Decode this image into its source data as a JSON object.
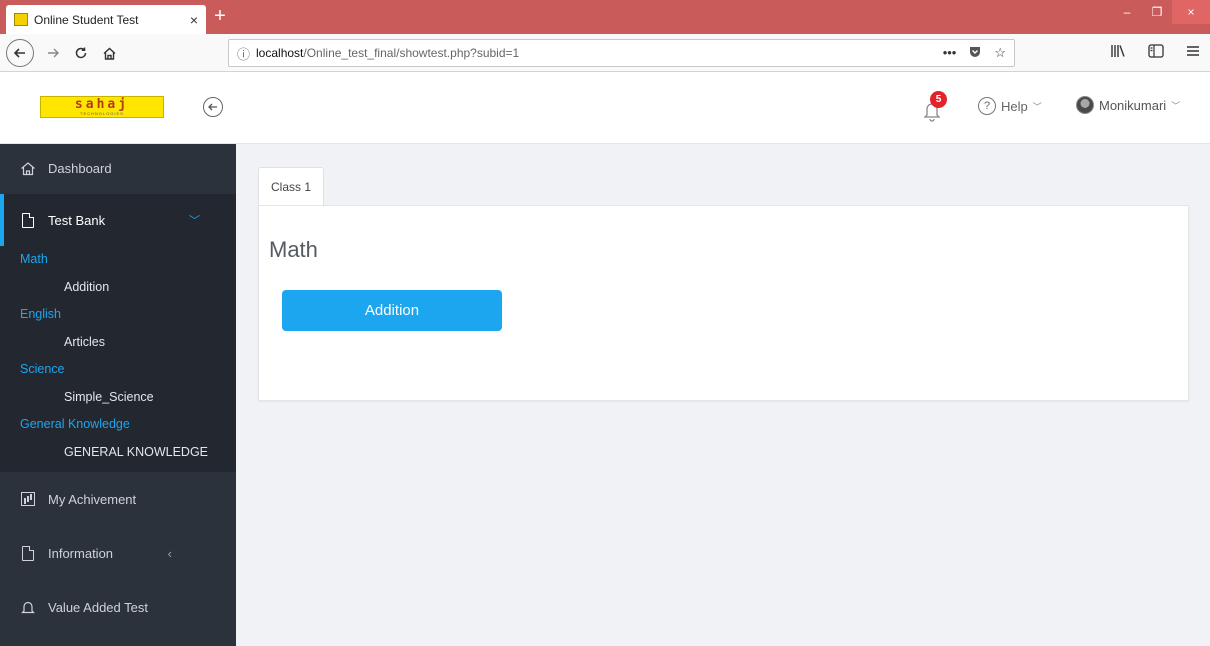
{
  "browser": {
    "tab_title": "Online Student Test",
    "tab_close": "×",
    "new_tab": "+",
    "url_host": "localhost",
    "url_path": "/Online_test_final/showtest.php?subid=1",
    "url_more": "•••",
    "win_min": "–",
    "win_max": "❐",
    "win_close": "×"
  },
  "header": {
    "logo_text": "sahaj",
    "logo_subtext": "TECHNOLOGIES",
    "notification_count": "5",
    "help_label": "Help",
    "user_name": "Monikumari"
  },
  "sidebar": {
    "dashboard": "Dashboard",
    "test_bank": "Test Bank",
    "categories": [
      {
        "label": "Math",
        "items": [
          "Addition"
        ]
      },
      {
        "label": "English",
        "items": [
          "Articles"
        ]
      },
      {
        "label": "Science",
        "items": [
          "Simple_Science"
        ]
      },
      {
        "label": "General Knowledge",
        "items": [
          "GENERAL KNOWLEDGE"
        ]
      }
    ],
    "achievement": "My Achivement",
    "information": "Information",
    "value_added": "Value Added Test"
  },
  "main": {
    "tab_label": "Class 1",
    "subject_title": "Math",
    "test_button": "Addition"
  },
  "colors": {
    "accent": "#1ba6ef",
    "sidebar_bg": "#2b323c",
    "titlebar": "#c95b5b",
    "badge": "#e0242a"
  }
}
